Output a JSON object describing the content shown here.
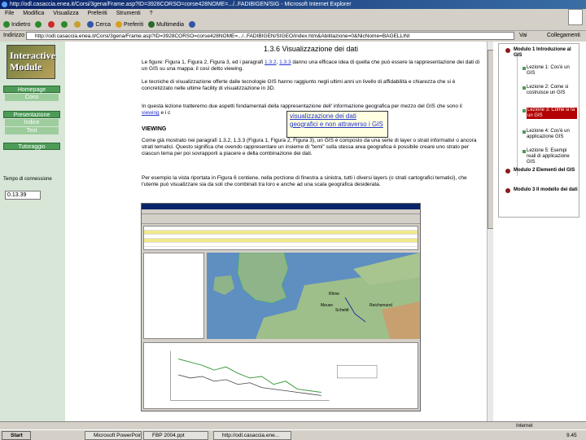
{
  "window": {
    "title": "http://odl.casaccia.enea.it/Corsi/3gena/Frame.asp?ID=3928CORSO=corse428NOME=.../..FADIBIGEN/SIG - Microsoft Internet Explorer"
  },
  "menu": [
    "File",
    "Modifica",
    "Visualizza",
    "Preferiti",
    "Strumenti",
    "?"
  ],
  "toolbar": [
    {
      "label": "Indietro",
      "icon": "back-icon",
      "color": "#2a8a2a"
    },
    {
      "label": "",
      "icon": "forward-icon",
      "color": "#2a8a2a"
    },
    {
      "label": "",
      "icon": "stop-icon",
      "color": "#cc2a2a"
    },
    {
      "label": "",
      "icon": "refresh-icon",
      "color": "#2a8a2a"
    },
    {
      "label": "",
      "icon": "home-icon",
      "color": "#c8a030"
    },
    {
      "label": "Cerca",
      "icon": "search-icon",
      "color": "#3355aa"
    },
    {
      "label": "Preferiti",
      "icon": "favorites-icon",
      "color": "#d4a020"
    },
    {
      "label": "Multimedia",
      "icon": "media-icon",
      "color": "#2a6a2a"
    },
    {
      "label": "",
      "icon": "history-icon",
      "color": "#3355aa"
    }
  ],
  "address": {
    "label": "Indirizzo",
    "url": "http://odl.casaccia.enea.it/Corsi/3gena/Frame.asp?ID=3928CORSO=corse428NOME=.../..FADIBIGEN/SIGEO/index.htm&Abilitazione=0&NicNome=BAGELLINI",
    "go_label": "Vai",
    "links_label": "Collegamenti"
  },
  "leftnav": {
    "logo": "Interactive Module",
    "buttons": [
      {
        "label": "Homepage",
        "sub": "Corsi"
      },
      {
        "label": "Presentazione",
        "sub": [
          "Indice",
          "Test"
        ]
      },
      {
        "label": "Tutoraggio"
      }
    ],
    "time_label": "Tempo di connessione",
    "time_value": "0.13.39"
  },
  "main": {
    "title": "1.3.6 Visualizzazione dei dati",
    "p1_a": "Le figure: Figura 1, Figura 2, Figura 3, ed i paragrafi",
    "p1_link1": "1.3.2",
    "p1_b": ",",
    "p1_link2": "1.3.3",
    "p1_c": "danno una efficace idea di quella che può essere la rappresentazione dei dati di un GIS su una mappa: il così detto viewing.",
    "p2": "Le tecniche di visualizzazione offerte dalle tecnologie GIS hanno raggiunto negli ultimi anni un livello di affidabilità e chiarezza che si è concretizzato nelle ultime facility di visualizzazione in 3D.",
    "p3_a": "In questa lezione tratteremo due aspetti fondamentali della rappresentazione dell' informazione geografica per mezzo del GIS che sono il",
    "p3_link": "viewing",
    "p3_b": "e i c",
    "heading": "VIEWING",
    "p4": "Come già mostrato nei paragrafi 1.3.2, 1.3.3 (Figura 1, Figura 2, Figura 3), un GIS è composto da una serie di layer o strati informativi o ancora strati tematici. Questo significa che ovendo rappresentare un insieme di \"temi\" sulla stessa area geografica è possibile creare uno strato per ciascun tema per poi sovrapporli a piacere e della combinazione dei dati.",
    "p5": "Per esempio la vista riportata in Figura 6 contiene, nella porzione di finestra a sinistra, tutti i diversi layers (o strati cartografici tematici), che l'utente può visualizzare sia da soli che combinati tra loro e anche ad una scala geografica desiderata.",
    "tooltip": "visualizzazione dei dati geografici e non attraverso i GIS",
    "figure_labels": [
      "Rhine",
      "Meuse",
      "Scheldt",
      "Reichsmund"
    ]
  },
  "toc": {
    "items": [
      {
        "type": "module",
        "label": "Modulo 1 Introduzione al GIS"
      },
      {
        "type": "lesson",
        "label": "Lezione 1: Cos'è un GIS",
        "active": false
      },
      {
        "type": "lesson",
        "label": "Lezione 2: Come si costruisce un GIS",
        "active": false
      },
      {
        "type": "lesson",
        "label": "Lezione 3: Come si fa un GIS",
        "active": true
      },
      {
        "type": "lesson",
        "label": "Lezione 4: Cos'è un applicazione GIS",
        "active": false
      },
      {
        "type": "lesson",
        "label": "Lezione 5: Esempi reali di applicazione GIS",
        "active": false
      },
      {
        "type": "module",
        "label": "Modulo 2 Elementi del GIS"
      },
      {
        "type": "module",
        "label": "Modulo 3 Il modello dei dati"
      }
    ]
  },
  "status": {
    "zone": "Internet"
  },
  "taskbar": {
    "start": "Start",
    "tasks": [
      "Microsoft PowerPoint",
      "FBP 2004.ppt",
      "http://odl.casaccia.ene..."
    ],
    "clock": "9.45"
  }
}
